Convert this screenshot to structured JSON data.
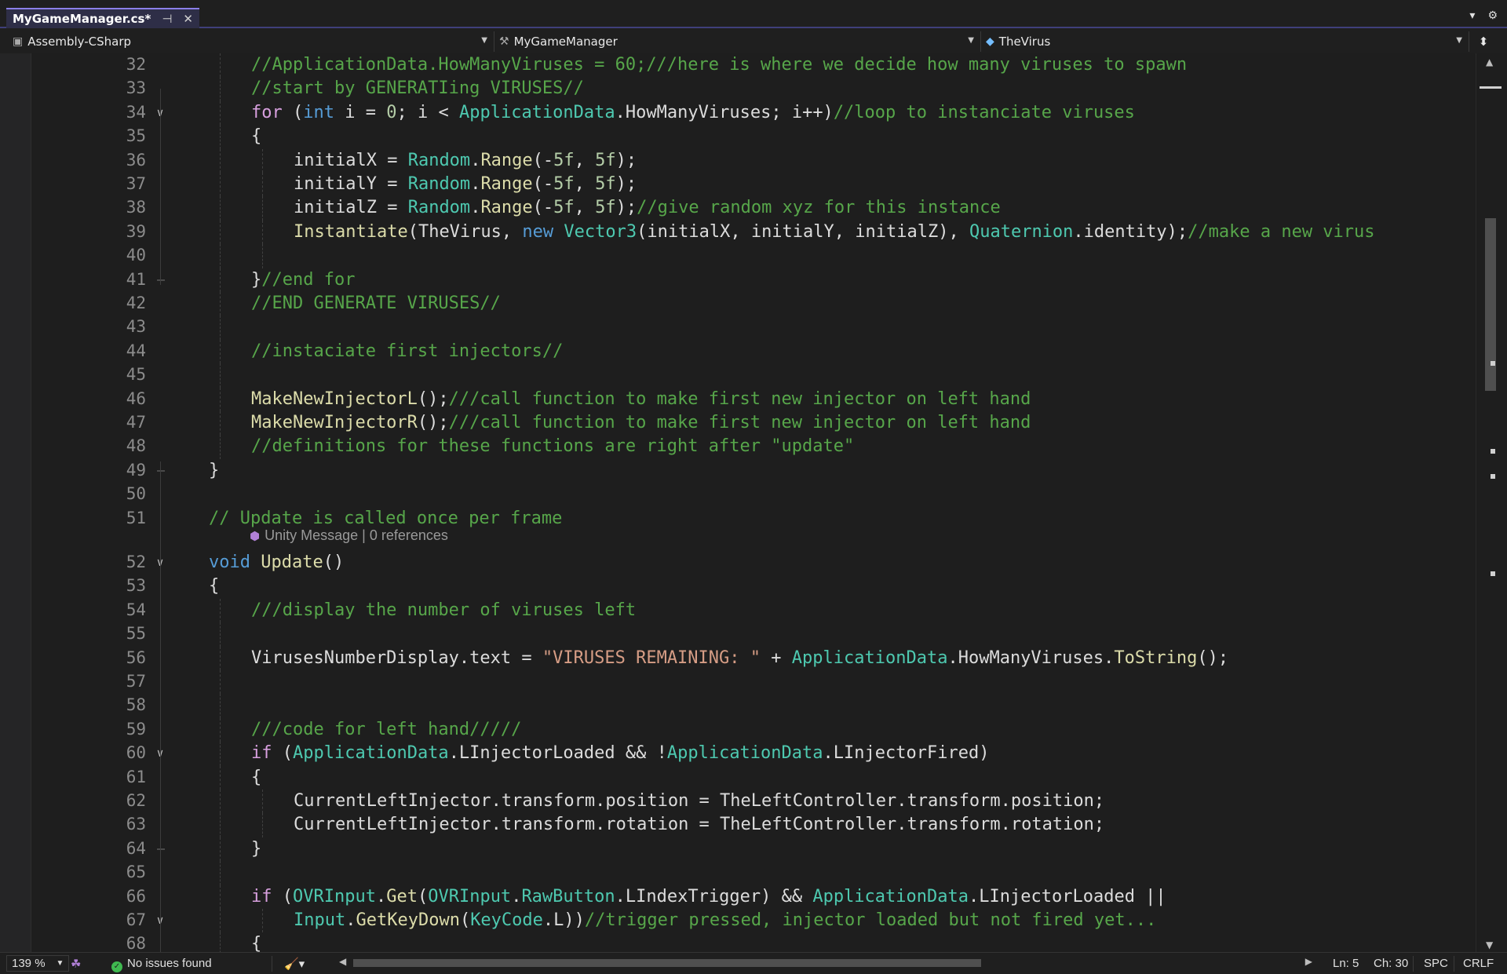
{
  "tab": {
    "title": "MyGameManager.cs*",
    "pin_icon": "pin-icon",
    "close_icon": "close-icon"
  },
  "nav": {
    "project": "Assembly-CSharp",
    "class": "MyGameManager",
    "member": "TheVirus"
  },
  "editor": {
    "lines": [
      {
        "n": "32",
        "indent": 2,
        "tokens": [
          [
            "cm",
            "//ApplicationData.HowManyViruses = 60;///here is where we decide how many viruses to spawn"
          ]
        ]
      },
      {
        "n": "33",
        "indent": 2,
        "tokens": [
          [
            "cm",
            "//start by GENERATIing VIRUSES//"
          ]
        ]
      },
      {
        "n": "34",
        "indent": 2,
        "fold": "open",
        "tokens": [
          [
            "ctl",
            "for"
          ],
          [
            "pl",
            " ("
          ],
          [
            "kw",
            "int"
          ],
          [
            "pl",
            " i = "
          ],
          [
            "nu",
            "0"
          ],
          [
            "pl",
            "; i < "
          ],
          [
            "ty",
            "ApplicationData"
          ],
          [
            "pl",
            ".HowManyViruses; i++)"
          ],
          [
            "cm",
            "//loop to instanciate viruses"
          ]
        ]
      },
      {
        "n": "35",
        "indent": 2,
        "tokens": [
          [
            "pl",
            "{"
          ]
        ]
      },
      {
        "n": "36",
        "indent": 3,
        "tokens": [
          [
            "pl",
            "initialX = "
          ],
          [
            "ty",
            "Random"
          ],
          [
            "pl",
            "."
          ],
          [
            "me",
            "Range"
          ],
          [
            "pl",
            "(-"
          ],
          [
            "nu",
            "5f"
          ],
          [
            "pl",
            ", "
          ],
          [
            "nu",
            "5f"
          ],
          [
            "pl",
            ");"
          ]
        ]
      },
      {
        "n": "37",
        "indent": 3,
        "tokens": [
          [
            "pl",
            "initialY = "
          ],
          [
            "ty",
            "Random"
          ],
          [
            "pl",
            "."
          ],
          [
            "me",
            "Range"
          ],
          [
            "pl",
            "(-"
          ],
          [
            "nu",
            "5f"
          ],
          [
            "pl",
            ", "
          ],
          [
            "nu",
            "5f"
          ],
          [
            "pl",
            ");"
          ]
        ]
      },
      {
        "n": "38",
        "indent": 3,
        "tokens": [
          [
            "pl",
            "initialZ = "
          ],
          [
            "ty",
            "Random"
          ],
          [
            "pl",
            "."
          ],
          [
            "me",
            "Range"
          ],
          [
            "pl",
            "(-"
          ],
          [
            "nu",
            "5f"
          ],
          [
            "pl",
            ", "
          ],
          [
            "nu",
            "5f"
          ],
          [
            "pl",
            ");"
          ],
          [
            "cm",
            "//give random xyz for this instance"
          ]
        ]
      },
      {
        "n": "39",
        "indent": 3,
        "tokens": [
          [
            "me",
            "Instantiate"
          ],
          [
            "pl",
            "(TheVirus, "
          ],
          [
            "kw",
            "new"
          ],
          [
            "pl",
            " "
          ],
          [
            "ty",
            "Vector3"
          ],
          [
            "pl",
            "(initialX, initialY, initialZ), "
          ],
          [
            "ty",
            "Quaternion"
          ],
          [
            "pl",
            ".identity);"
          ],
          [
            "cm",
            "//make a new virus"
          ]
        ]
      },
      {
        "n": "40",
        "indent": 3,
        "tokens": []
      },
      {
        "n": "41",
        "indent": 2,
        "foldEnd": true,
        "tokens": [
          [
            "pl",
            "}"
          ],
          [
            "cm",
            "//end for"
          ]
        ]
      },
      {
        "n": "42",
        "indent": 2,
        "tokens": [
          [
            "cm",
            "//END GENERATE VIRUSES//"
          ]
        ]
      },
      {
        "n": "43",
        "indent": 2,
        "tokens": []
      },
      {
        "n": "44",
        "indent": 2,
        "tokens": [
          [
            "cm",
            "//instaciate first injectors//"
          ]
        ]
      },
      {
        "n": "45",
        "indent": 2,
        "tokens": []
      },
      {
        "n": "46",
        "indent": 2,
        "tokens": [
          [
            "me",
            "MakeNewInjectorL"
          ],
          [
            "pl",
            "();"
          ],
          [
            "cm",
            "///call function to make first new injector on left hand"
          ]
        ]
      },
      {
        "n": "47",
        "indent": 2,
        "tokens": [
          [
            "me",
            "MakeNewInjectorR"
          ],
          [
            "pl",
            "();"
          ],
          [
            "cm",
            "///call function to make first new injector on left hand"
          ]
        ]
      },
      {
        "n": "48",
        "indent": 2,
        "tokens": [
          [
            "cm",
            "//definitions for these functions are right after \"update\""
          ]
        ]
      },
      {
        "n": "49",
        "indent": 1,
        "foldEnd": true,
        "tokens": [
          [
            "pl",
            "}"
          ]
        ]
      },
      {
        "n": "50",
        "indent": 1,
        "tokens": []
      },
      {
        "n": "51",
        "indent": 1,
        "tokens": [
          [
            "cm",
            "// Update is called once per frame"
          ]
        ]
      },
      {
        "lens": true,
        "text_a": "Unity Message",
        "text_b": "0 references"
      },
      {
        "n": "52",
        "indent": 1,
        "fold": "open",
        "tokens": [
          [
            "kw",
            "void"
          ],
          [
            "pl",
            " "
          ],
          [
            "me",
            "Update"
          ],
          [
            "pl",
            "()"
          ]
        ]
      },
      {
        "n": "53",
        "indent": 1,
        "tokens": [
          [
            "pl",
            "{"
          ]
        ]
      },
      {
        "n": "54",
        "indent": 2,
        "tokens": [
          [
            "cm",
            "///display the number of viruses left"
          ]
        ]
      },
      {
        "n": "55",
        "indent": 2,
        "tokens": []
      },
      {
        "n": "56",
        "indent": 2,
        "tokens": [
          [
            "pl",
            "VirusesNumberDisplay.text = "
          ],
          [
            "st",
            "\"VIRUSES REMAINING: \""
          ],
          [
            "pl",
            " + "
          ],
          [
            "ty",
            "ApplicationData"
          ],
          [
            "pl",
            ".HowManyViruses."
          ],
          [
            "me",
            "ToString"
          ],
          [
            "pl",
            "();"
          ]
        ]
      },
      {
        "n": "57",
        "indent": 2,
        "tokens": []
      },
      {
        "n": "58",
        "indent": 2,
        "tokens": []
      },
      {
        "n": "59",
        "indent": 2,
        "tokens": [
          [
            "cm",
            "///code for left hand/////"
          ]
        ]
      },
      {
        "n": "60",
        "indent": 2,
        "fold": "open",
        "tokens": [
          [
            "ctl",
            "if"
          ],
          [
            "pl",
            " ("
          ],
          [
            "ty",
            "ApplicationData"
          ],
          [
            "pl",
            ".LInjectorLoaded && !"
          ],
          [
            "ty",
            "ApplicationData"
          ],
          [
            "pl",
            ".LInjectorFired)"
          ]
        ]
      },
      {
        "n": "61",
        "indent": 2,
        "tokens": [
          [
            "pl",
            "{"
          ]
        ]
      },
      {
        "n": "62",
        "indent": 3,
        "tokens": [
          [
            "pl",
            "CurrentLeftInjector.transform.position = TheLeftController.transform.position;"
          ]
        ]
      },
      {
        "n": "63",
        "indent": 3,
        "tokens": [
          [
            "pl",
            "CurrentLeftInjector.transform.rotation = TheLeftController.transform.rotation;"
          ]
        ]
      },
      {
        "n": "64",
        "indent": 2,
        "foldEnd": true,
        "tokens": [
          [
            "pl",
            "}"
          ]
        ]
      },
      {
        "n": "65",
        "indent": 2,
        "tokens": []
      },
      {
        "n": "66",
        "indent": 2,
        "tokens": [
          [
            "ctl",
            "if"
          ],
          [
            "pl",
            " ("
          ],
          [
            "ty",
            "OVRInput"
          ],
          [
            "pl",
            "."
          ],
          [
            "me",
            "Get"
          ],
          [
            "pl",
            "("
          ],
          [
            "ty",
            "OVRInput"
          ],
          [
            "pl",
            "."
          ],
          [
            "ty",
            "RawButton"
          ],
          [
            "pl",
            ".LIndexTrigger) && "
          ],
          [
            "ty",
            "ApplicationData"
          ],
          [
            "pl",
            ".LInjectorLoaded ||"
          ]
        ]
      },
      {
        "n": "67",
        "indent": 3,
        "fold": "open",
        "tokens": [
          [
            "ty",
            "Input"
          ],
          [
            "pl",
            "."
          ],
          [
            "me",
            "GetKeyDown"
          ],
          [
            "pl",
            "("
          ],
          [
            "ty",
            "KeyCode"
          ],
          [
            "pl",
            ".L))"
          ],
          [
            "cm",
            "//trigger pressed, injector loaded but not fired yet..."
          ]
        ]
      },
      {
        "n": "68",
        "indent": 2,
        "tokens": [
          [
            "pl",
            "{"
          ]
        ]
      }
    ]
  },
  "status": {
    "zoom": "139 %",
    "issues": "No issues found",
    "ln": "Ln: 5",
    "ch": "Ch: 30",
    "spc": "SPC",
    "crlf": "CRLF"
  },
  "colors": {
    "comment": "#57a64a",
    "keyword": "#569cd6",
    "control": "#d8a0df",
    "type": "#4ec9b0",
    "method": "#dcdcaa",
    "string": "#d69d85",
    "number": "#b5cea8"
  }
}
